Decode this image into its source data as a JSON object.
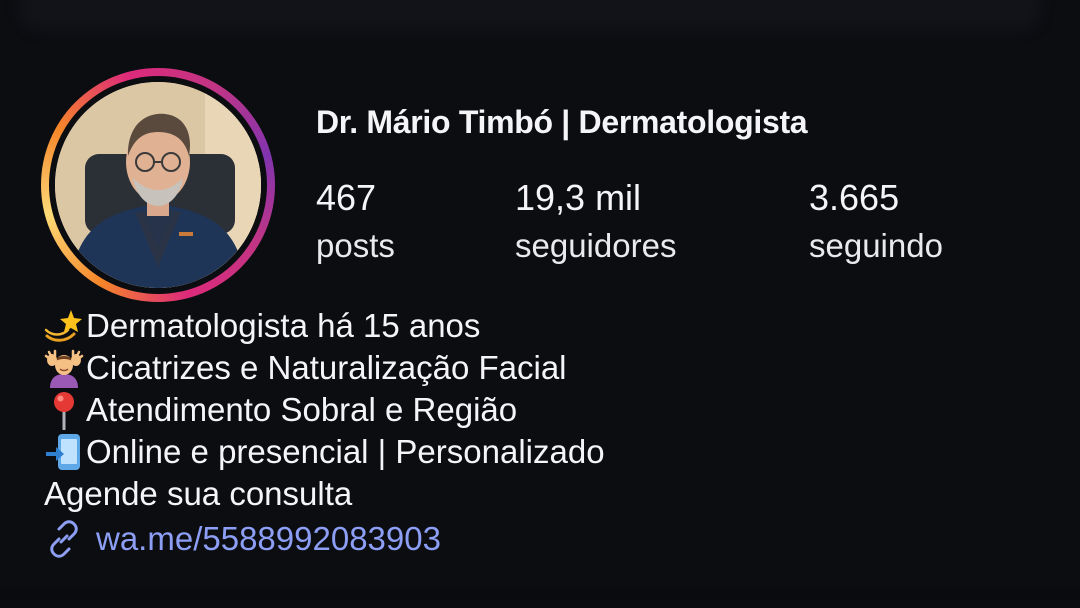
{
  "profile": {
    "name": "Dr. Mário Timbó | Dermatologista",
    "avatar_icon": "profile-photo"
  },
  "stats": {
    "posts": {
      "value": "467",
      "label": "posts"
    },
    "followers": {
      "value": "19,3 mil",
      "label": "seguidores"
    },
    "following": {
      "value": "3.665",
      "label": "seguindo"
    }
  },
  "bio": {
    "lines": [
      {
        "icon": "dizzy-star-emoji",
        "text": "Dermatologista há 15 anos"
      },
      {
        "icon": "face-massage-emoji",
        "text": "Cicatrizes e Naturalização Facial"
      },
      {
        "icon": "round-pushpin-emoji",
        "text": "Atendimento Sobral e Região"
      },
      {
        "icon": "mobile-arrow-emoji",
        "text": "Online e presencial | Personalizado"
      }
    ],
    "cta": "Agende sua consulta"
  },
  "link": {
    "icon": "link-icon",
    "text": "wa.me/5588992083903",
    "color": "#8d9ef5"
  },
  "colors": {
    "background": "#0c0d11",
    "text": "#f5f5f7",
    "story_ring": [
      "#f58529",
      "#feda77",
      "#dd2a7b",
      "#8134af"
    ]
  }
}
